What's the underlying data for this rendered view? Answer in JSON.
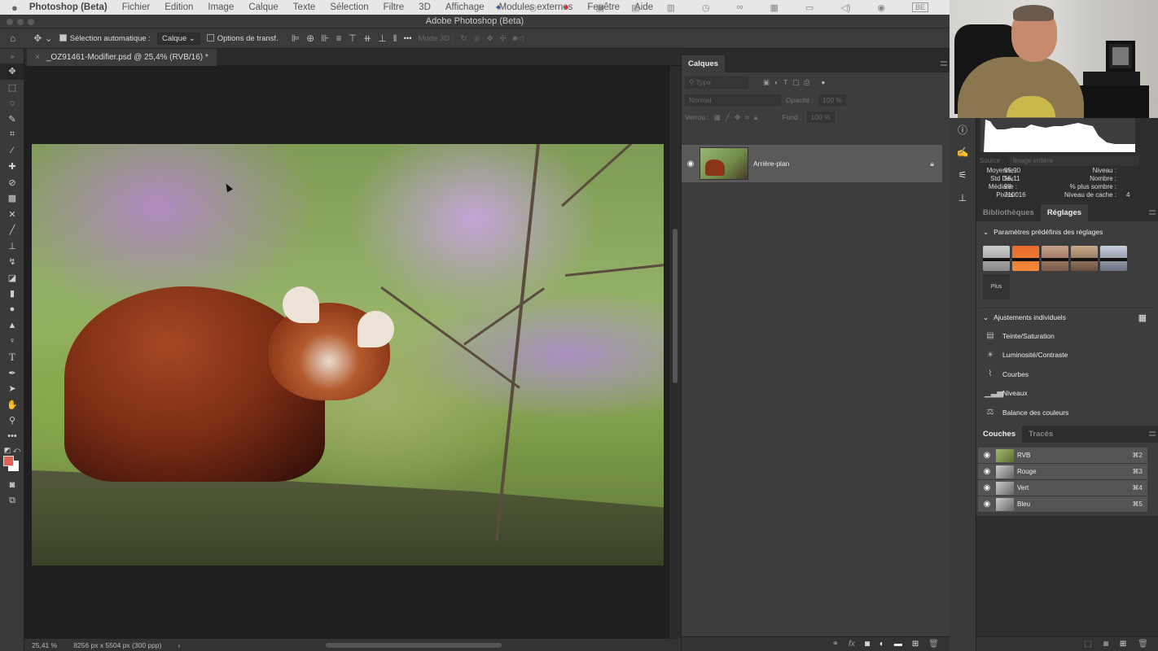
{
  "menubar": {
    "apple": "",
    "app_name": "Photoshop (Beta)",
    "items": [
      "Fichier",
      "Edition",
      "Image",
      "Calque",
      "Texte",
      "Sélection",
      "Filtre",
      "3D",
      "Affichage",
      "Modules externes",
      "Fenêtre",
      "Aide"
    ],
    "tray": [
      "butterfly-icon",
      "creative-cloud-icon",
      "notifications-icon",
      "camera-icon",
      "screen-icon",
      "clipboard-icon",
      "clock-icon",
      "binoculars-icon",
      "layout-icon",
      "display-icon",
      "volume-icon",
      "user-icon"
    ],
    "tray_badge": "BE"
  },
  "window": {
    "title": "Adobe Photoshop (Beta)"
  },
  "options_bar": {
    "auto_select_label": "Sélection automatique :",
    "auto_select_checked": true,
    "auto_select_target": "Calque",
    "transform_options_label": "Options de transf.",
    "more": "•••",
    "mode_3d_label": "Mode 3D :"
  },
  "tools": [
    "move",
    "marquee",
    "lasso",
    "quick-select",
    "crop",
    "eyedropper",
    "spot-healing",
    "healing-brush",
    "patch",
    "content-aware-move",
    "brush",
    "clone-stamp",
    "history-brush",
    "eraser",
    "gradient",
    "blur",
    "sharpen",
    "dodge",
    "type",
    "pen",
    "path-selection",
    "hand",
    "zoom",
    "more-tools"
  ],
  "colors": {
    "foreground": "#e46052",
    "background": "#ffffff"
  },
  "document": {
    "tab_title": "_OZ91461-Modifier.psd @ 25,4% (RVB/16) *",
    "close": "×",
    "zoom": "25,41 %",
    "dimensions": "8256 px x 5504 px (300 ppp)",
    "status_arrow": "›"
  },
  "layers_panel": {
    "tab": "Calques",
    "filter_placeholder": "Type",
    "blend_mode": "Normal",
    "opacity_label": "Opacité :",
    "opacity": "100 %",
    "lock_label": "Verrou :",
    "fill_label": "Fond :",
    "fill": "100 %",
    "layers": [
      {
        "name": "Arrière-plan",
        "visible": true,
        "locked": true
      }
    ],
    "footer_icons": [
      "link-icon",
      "fx-icon",
      "mask-icon",
      "adjustment-icon",
      "folder-icon",
      "new-layer-icon",
      "trash-icon"
    ]
  },
  "histogram": {
    "source_label": "Source :",
    "source": "Image entière",
    "stats": [
      {
        "label": "Moyenne :",
        "value": "95,90"
      },
      {
        "label": "Std Dev :",
        "value": "55,11"
      },
      {
        "label": "Médiane :",
        "value": "98"
      },
      {
        "label": "Pixels :",
        "value": "710016"
      }
    ],
    "right_stats": [
      {
        "label": "Niveau :",
        "value": ""
      },
      {
        "label": "Nombre :",
        "value": ""
      },
      {
        "label": "% plus sombre :",
        "value": ""
      },
      {
        "label": "Niveau de cache :",
        "value": "4"
      }
    ]
  },
  "adjustments_panel": {
    "tabs": [
      "Bibliothèques",
      "Réglages"
    ],
    "active_tab": "Réglages",
    "presets_heading": "Paramètres prédéfinis des réglages",
    "presets_more": "Plus",
    "individual_heading": "Ajustements individuels",
    "items": [
      "Teinte/Saturation",
      "Luminosité/Contraste",
      "Courbes",
      "Niveaux",
      "Balance des couleurs"
    ]
  },
  "channels_panel": {
    "tabs": [
      "Couches",
      "Tracés"
    ],
    "active_tab": "Couches",
    "channels": [
      {
        "name": "RVB",
        "shortcut": "⌘2"
      },
      {
        "name": "Rouge",
        "shortcut": "⌘3"
      },
      {
        "name": "Vert",
        "shortcut": "⌘4"
      },
      {
        "name": "Bleu",
        "shortcut": "⌘5"
      }
    ]
  }
}
